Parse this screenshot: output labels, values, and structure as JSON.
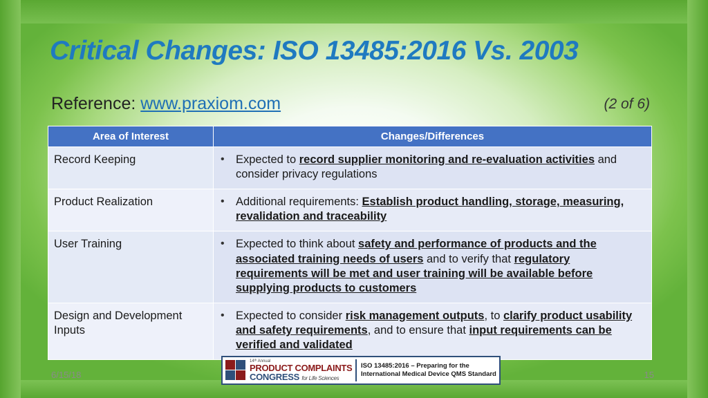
{
  "slide": {
    "title": "Critical Changes:  ISO 13485:2016 Vs. 2003",
    "reference_label": "Reference:",
    "reference_link": "www.praxiom.com",
    "page_of": "(2 of 6)",
    "footer_date": "6/15/18",
    "footer_number": "15"
  },
  "table": {
    "headers": {
      "area": "Area of Interest",
      "changes": "Changes/Differences"
    },
    "rows": [
      {
        "area": "Record Keeping",
        "bullet": "•",
        "parts": [
          {
            "text": "Expected to ",
            "underline": false
          },
          {
            "text": "record supplier monitoring and re-evaluation activities",
            "underline": true
          },
          {
            "text": " and consider privacy regulations",
            "underline": false
          }
        ]
      },
      {
        "area": "Product Realization",
        "bullet": "•",
        "parts": [
          {
            "text": "Additional requirements:  ",
            "underline": false
          },
          {
            "text": "Establish product handling, storage, measuring, revalidation and traceability",
            "underline": true
          }
        ]
      },
      {
        "area": "User Training",
        "bullet": "•",
        "parts": [
          {
            "text": "Expected to think about ",
            "underline": false
          },
          {
            "text": "safety and performance of products and the associated training needs of users",
            "underline": true
          },
          {
            "text": " and to verify that ",
            "underline": false
          },
          {
            "text": "regulatory requirements will be met and user training will be available before supplying products to customers",
            "underline": true
          }
        ]
      },
      {
        "area": "Design and Development Inputs",
        "bullet": "•",
        "parts": [
          {
            "text": "Expected to consider ",
            "underline": false
          },
          {
            "text": "risk management outputs",
            "underline": true
          },
          {
            "text": ", to ",
            "underline": false
          },
          {
            "text": "clarify product usability and safety requirements",
            "underline": true
          },
          {
            "text": ", and to ensure that ",
            "underline": false
          },
          {
            "text": "input requirements can be verified and validated",
            "underline": true
          }
        ]
      }
    ]
  },
  "logo": {
    "superscript": "14ᵗʰ Annual",
    "line1": "PRODUCT COMPLAINTS",
    "line2_main": "CONGRESS",
    "line2_small": "for Life Sciences",
    "caption_line1": "ISO 13485:2016 – Preparing for the",
    "caption_line2": "International Medical Device QMS Standard"
  },
  "colors": {
    "title": "#1f7ac0",
    "header_bg": "#4472c4",
    "row_bg": "#dde3f3",
    "slide_green": "#63b23a"
  }
}
